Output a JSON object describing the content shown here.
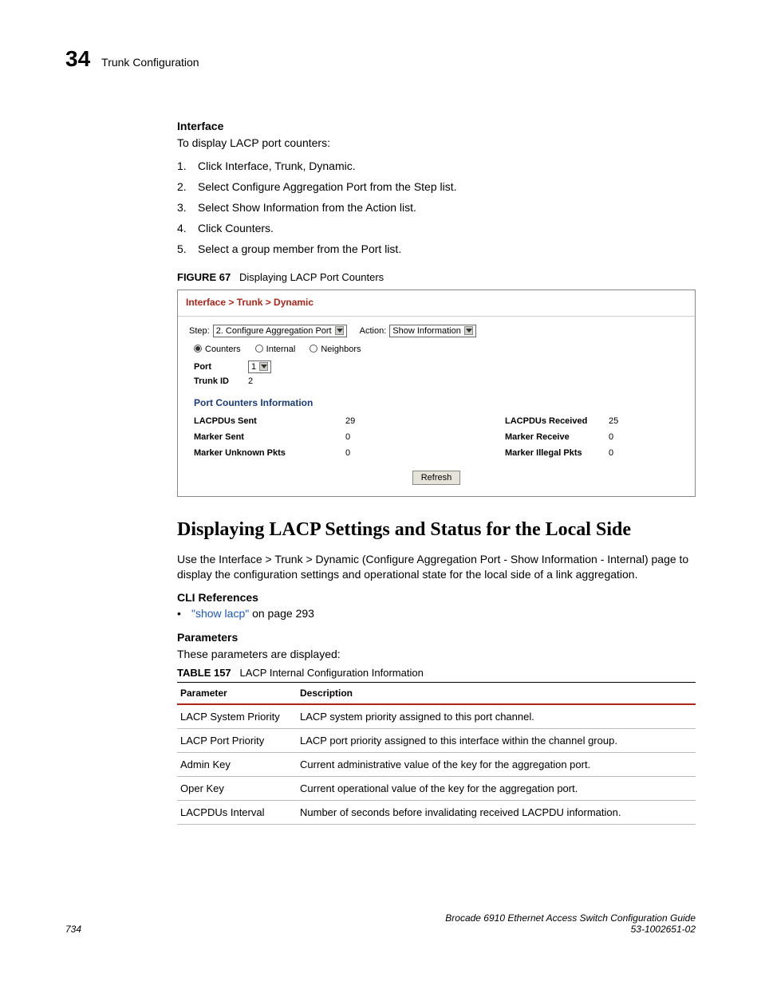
{
  "header": {
    "chapter_number": "34",
    "chapter_title": "Trunk Configuration"
  },
  "interface_section": {
    "label": "Interface",
    "intro": "To display LACP port counters:",
    "steps": [
      "Click Interface, Trunk, Dynamic.",
      "Select Configure Aggregation Port from the Step list.",
      "Select Show Information from the Action list.",
      "Click Counters.",
      "Select a group member from the Port list."
    ]
  },
  "figure": {
    "label": "FIGURE 67",
    "title": "Displaying LACP Port Counters"
  },
  "screenshot": {
    "breadcrumb": "Interface > Trunk > Dynamic",
    "step_label": "Step:",
    "step_value": "2. Configure Aggregation Port",
    "action_label": "Action:",
    "action_value": "Show Information",
    "radios": {
      "counters": "Counters",
      "internal": "Internal",
      "neighbors": "Neighbors"
    },
    "port_label": "Port",
    "port_value": "1",
    "trunk_id_label": "Trunk ID",
    "trunk_id_value": "2",
    "section_header": "Port Counters Information",
    "rows": [
      {
        "k1": "LACPDUs Sent",
        "v1": "29",
        "k2": "LACPDUs Received",
        "v2": "25"
      },
      {
        "k1": "Marker Sent",
        "v1": "0",
        "k2": "Marker Receive",
        "v2": "0"
      },
      {
        "k1": "Marker Unknown Pkts",
        "v1": "0",
        "k2": "Marker Illegal Pkts",
        "v2": "0"
      }
    ],
    "refresh": "Refresh"
  },
  "local_side": {
    "heading": "Displaying LACP Settings and Status for the Local Side",
    "body": "Use the Interface > Trunk > Dynamic (Configure Aggregation Port - Show Information - Internal) page to display the configuration settings and operational state for the local side of a link aggregation.",
    "cli_label": "CLI References",
    "cli_link": "\"show lacp\"",
    "cli_suffix": " on page 293",
    "params_label": "Parameters",
    "params_intro": "These parameters are displayed:"
  },
  "table": {
    "label": "TABLE 157",
    "title": "LACP Internal Configuration Information",
    "headers": {
      "param": "Parameter",
      "desc": "Description"
    },
    "rows": [
      {
        "p": "LACP System Priority",
        "d": "LACP system priority assigned to this port channel."
      },
      {
        "p": "LACP Port Priority",
        "d": "LACP port priority assigned to this interface within the channel group."
      },
      {
        "p": "Admin Key",
        "d": "Current administrative value of the key for the aggregation port."
      },
      {
        "p": "Oper Key",
        "d": "Current operational value of the key for the aggregation port."
      },
      {
        "p": "LACPDUs Interval",
        "d": "Number of seconds before invalidating received LACPDU information."
      }
    ]
  },
  "footer": {
    "page": "734",
    "doc_title": "Brocade 6910 Ethernet Access Switch Configuration Guide",
    "doc_id": "53-1002651-02"
  }
}
